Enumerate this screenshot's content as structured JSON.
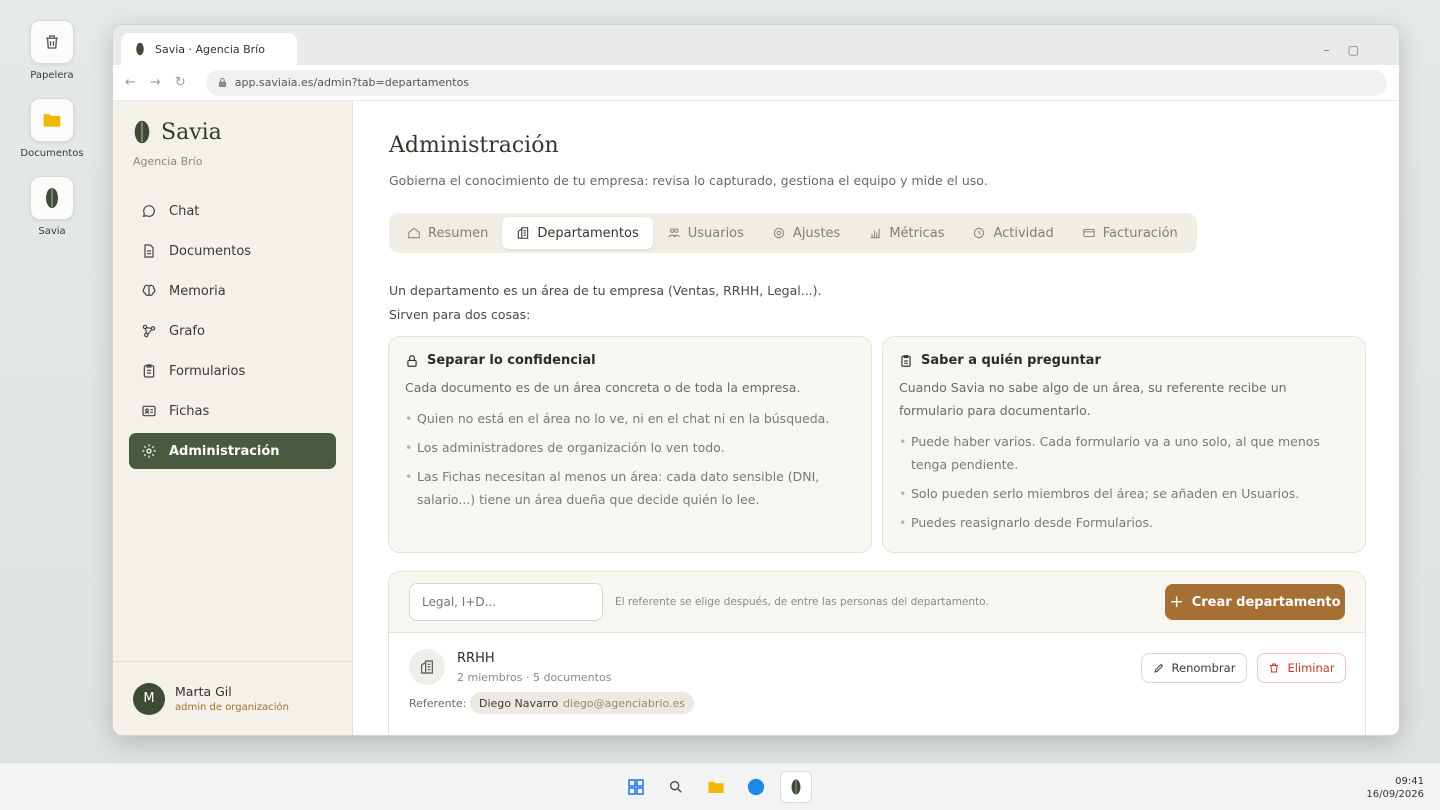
{
  "desktop": {
    "icons": [
      {
        "label": "Papelera",
        "icon": "trash-icon"
      },
      {
        "label": "Documentos",
        "icon": "folder-icon"
      },
      {
        "label": "Savia",
        "icon": "leaf-icon"
      }
    ]
  },
  "browser": {
    "tab_title": "Savia · Agencia Brío",
    "url": "app.saviaia.es/admin?tab=departamentos"
  },
  "sidebar": {
    "brand": "Savia",
    "org": "Agencia Brío",
    "items": [
      {
        "label": "Chat",
        "icon": "chat-icon"
      },
      {
        "label": "Documentos",
        "icon": "document-icon"
      },
      {
        "label": "Memoria",
        "icon": "brain-icon"
      },
      {
        "label": "Grafo",
        "icon": "graph-icon"
      },
      {
        "label": "Formularios",
        "icon": "clipboard-icon"
      },
      {
        "label": "Fichas",
        "icon": "id-card-icon"
      },
      {
        "label": "Administración",
        "icon": "gear-icon",
        "active": true
      }
    ],
    "user": {
      "initial": "M",
      "name": "Marta Gil",
      "role": "admin de organización"
    }
  },
  "main": {
    "title": "Administración",
    "subtitle": "Gobierna el conocimiento de tu empresa: revisa lo capturado, gestiona el equipo y mide el uso.",
    "tabs": [
      {
        "label": "Resumen",
        "icon": "home-icon"
      },
      {
        "label": "Departamentos",
        "icon": "building-icon",
        "active": true
      },
      {
        "label": "Usuarios",
        "icon": "users-icon"
      },
      {
        "label": "Ajustes",
        "icon": "gear-icon"
      },
      {
        "label": "Métricas",
        "icon": "bar-chart-icon"
      },
      {
        "label": "Actividad",
        "icon": "clock-icon"
      },
      {
        "label": "Facturación",
        "icon": "credit-card-icon"
      }
    ],
    "intro_line1": "Un departamento es un área de tu empresa (Ventas, RRHH, Legal...).",
    "intro_line2": "Sirven para dos cosas:",
    "card_left": {
      "title": "Separar lo confidencial",
      "desc": "Cada documento es de un área concreta o de toda la empresa.",
      "bullets": [
        "Quien no está en el área no lo ve, ni en el chat ni en la búsqueda.",
        "Los administradores de organización lo ven todo.",
        "Las Fichas necesitan al menos un área: cada dato sensible (DNI, salario...) tiene un área dueña que decide quién lo lee."
      ]
    },
    "card_right": {
      "title": "Saber a quién preguntar",
      "desc": "Cuando Savia no sabe algo de un área, su referente recibe un formulario para documentarlo.",
      "bullets": [
        "Puede haber varios. Cada formulario va a uno solo, al que menos tenga pendiente.",
        "Solo pueden serlo miembros del área; se añaden en Usuarios.",
        "Puedes reasignarlo desde Formularios."
      ]
    },
    "create": {
      "placeholder": "Legal, I+D...",
      "hint": "El referente se elige después, de entre las personas del departamento.",
      "button": "Crear departamento"
    },
    "departments": [
      {
        "name": "RRHH",
        "meta": "2 miembros · 5 documentos",
        "ref_label": "Referente:",
        "ref_name": "Diego Navarro",
        "ref_email": "diego@agenciabrio.es",
        "rename": "Renombrar",
        "delete": "Eliminar"
      }
    ]
  },
  "taskbar": {
    "time": "09:41",
    "date": "16/09/2026"
  }
}
